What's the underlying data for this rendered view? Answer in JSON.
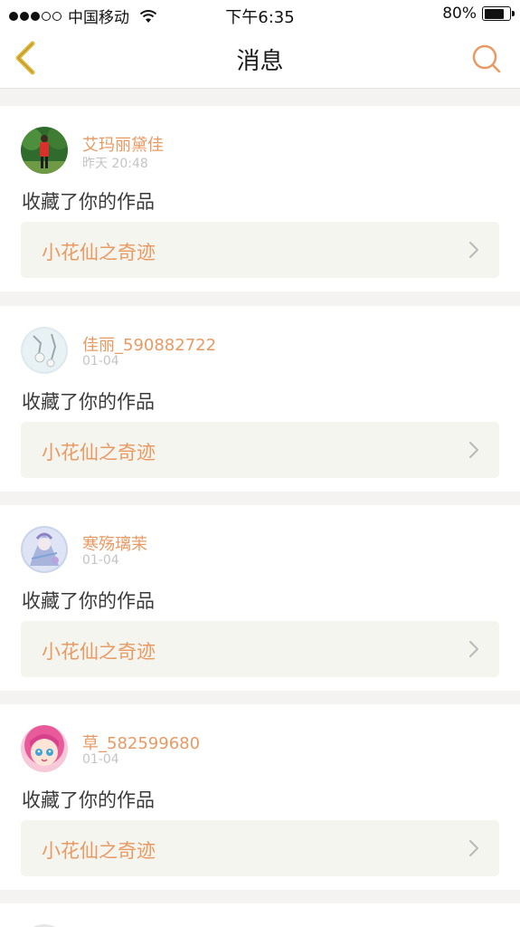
{
  "status_bar": {
    "carrier": "中国移动",
    "time": "下午6:35",
    "battery": "80%",
    "battery_level": 0.8
  },
  "header": {
    "title": "消息"
  },
  "messages": [
    {
      "user": "艾玛丽黛佳",
      "time": "昨天 20:48",
      "action": "收藏了你的作品",
      "work": "小花仙之奇迹"
    },
    {
      "user": "佳丽_590882722",
      "time": "01-04",
      "action": "收藏了你的作品",
      "work": "小花仙之奇迹"
    },
    {
      "user": "寒殇璃茉",
      "time": "01-04",
      "action": "收藏了你的作品",
      "work": "小花仙之奇迹"
    },
    {
      "user": "草_582599680",
      "time": "01-04",
      "action": "收藏了你的作品",
      "work": "小花仙之奇迹"
    }
  ],
  "colors": {
    "accent": "#e99a63",
    "back_icon": "#e0b73a",
    "page_bg": "#f4f3f2",
    "link_bg": "#f5f5ef"
  }
}
